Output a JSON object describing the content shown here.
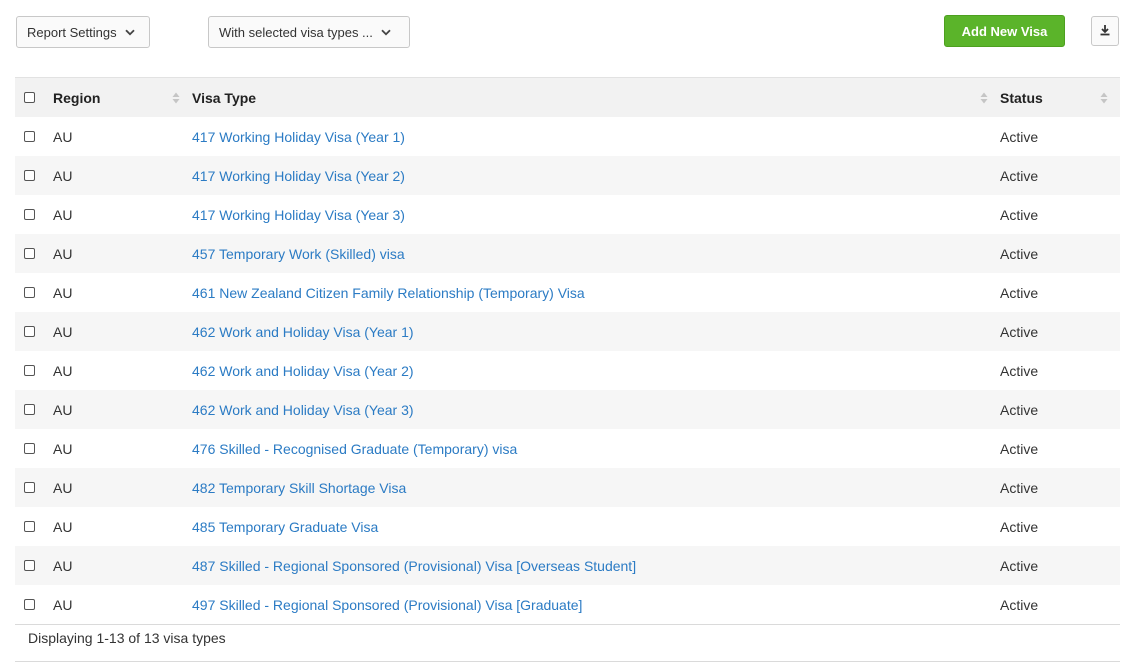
{
  "toolbar": {
    "report_settings_label": "Report Settings",
    "bulk_action_label": "With selected visa types ...",
    "add_button_label": "Add New Visa",
    "accent_color": "#5bb42a"
  },
  "table": {
    "columns": {
      "region": "Region",
      "visa_type": "Visa Type",
      "status": "Status"
    },
    "rows": [
      {
        "region": "AU",
        "visa_type": "417 Working Holiday Visa (Year 1)",
        "status": "Active"
      },
      {
        "region": "AU",
        "visa_type": "417 Working Holiday Visa (Year 2)",
        "status": "Active"
      },
      {
        "region": "AU",
        "visa_type": "417 Working Holiday Visa (Year 3)",
        "status": "Active"
      },
      {
        "region": "AU",
        "visa_type": "457 Temporary Work (Skilled) visa",
        "status": "Active"
      },
      {
        "region": "AU",
        "visa_type": "461 New Zealand Citizen Family Relationship (Temporary) Visa",
        "status": "Active"
      },
      {
        "region": "AU",
        "visa_type": "462 Work and Holiday Visa (Year 1)",
        "status": "Active"
      },
      {
        "region": "AU",
        "visa_type": "462 Work and Holiday Visa (Year 2)",
        "status": "Active"
      },
      {
        "region": "AU",
        "visa_type": "462 Work and Holiday Visa (Year 3)",
        "status": "Active"
      },
      {
        "region": "AU",
        "visa_type": "476 Skilled - Recognised Graduate (Temporary) visa",
        "status": "Active"
      },
      {
        "region": "AU",
        "visa_type": "482 Temporary Skill Shortage Visa",
        "status": "Active"
      },
      {
        "region": "AU",
        "visa_type": "485 Temporary Graduate Visa",
        "status": "Active"
      },
      {
        "region": "AU",
        "visa_type": "487 Skilled - Regional Sponsored (Provisional) Visa [Overseas Student]",
        "status": "Active"
      },
      {
        "region": "AU",
        "visa_type": "497 Skilled - Regional Sponsored (Provisional) Visa [Graduate]",
        "status": "Active"
      }
    ]
  },
  "footer": {
    "summary": "Displaying 1-13 of 13 visa types"
  },
  "icons": {
    "dropdown": "chevron-down-icon",
    "sort": "sort-icon",
    "download": "download-icon"
  }
}
